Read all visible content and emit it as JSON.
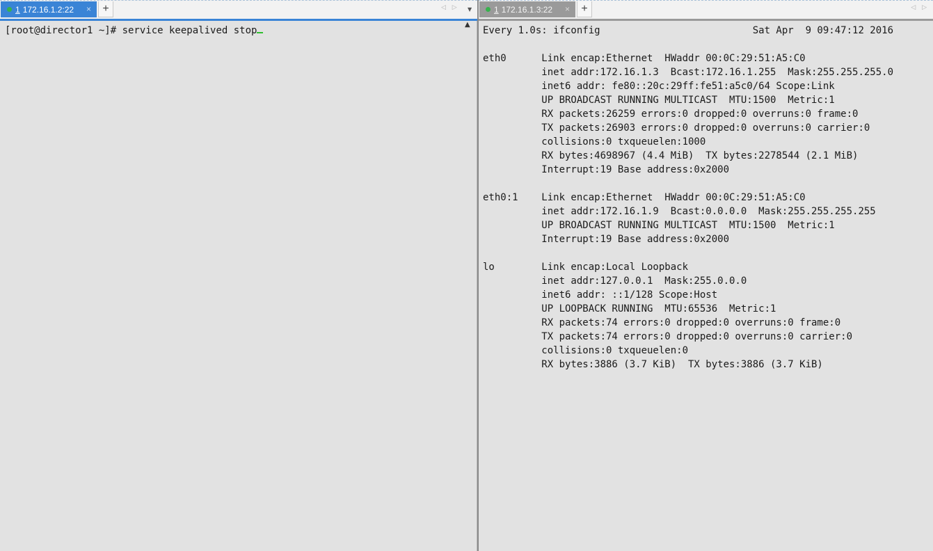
{
  "left": {
    "tab": {
      "number": "1",
      "title": "172.16.1.2:22",
      "close": "×"
    },
    "new_tab": "+",
    "prompt": "[root@director1 ~]# ",
    "command": "service keepalived stop"
  },
  "right": {
    "tab": {
      "number": "1",
      "title": "172.16.1.3:22",
      "close": "×"
    },
    "new_tab": "+",
    "lines": [
      "Every 1.0s: ifconfig                          Sat Apr  9 09:47:12 2016",
      "",
      "eth0      Link encap:Ethernet  HWaddr 00:0C:29:51:A5:C0",
      "          inet addr:172.16.1.3  Bcast:172.16.1.255  Mask:255.255.255.0",
      "          inet6 addr: fe80::20c:29ff:fe51:a5c0/64 Scope:Link",
      "          UP BROADCAST RUNNING MULTICAST  MTU:1500  Metric:1",
      "          RX packets:26259 errors:0 dropped:0 overruns:0 frame:0",
      "          TX packets:26903 errors:0 dropped:0 overruns:0 carrier:0",
      "          collisions:0 txqueuelen:1000",
      "          RX bytes:4698967 (4.4 MiB)  TX bytes:2278544 (2.1 MiB)",
      "          Interrupt:19 Base address:0x2000",
      "",
      "eth0:1    Link encap:Ethernet  HWaddr 00:0C:29:51:A5:C0",
      "          inet addr:172.16.1.9  Bcast:0.0.0.0  Mask:255.255.255.255",
      "          UP BROADCAST RUNNING MULTICAST  MTU:1500  Metric:1",
      "          Interrupt:19 Base address:0x2000",
      "",
      "lo        Link encap:Local Loopback",
      "          inet addr:127.0.0.1  Mask:255.0.0.0",
      "          inet6 addr: ::1/128 Scope:Host",
      "          UP LOOPBACK RUNNING  MTU:65536  Metric:1",
      "          RX packets:74 errors:0 dropped:0 overruns:0 frame:0",
      "          TX packets:74 errors:0 dropped:0 overruns:0 carrier:0",
      "          collisions:0 txqueuelen:0",
      "          RX bytes:3886 (3.7 KiB)  TX bytes:3886 (3.7 KiB)"
    ]
  },
  "icons": {
    "nav_arrows": "◁ ▷",
    "dropdown": "▼",
    "scroll_up": "▲"
  },
  "colors": {
    "active_tab": "#3a84d6",
    "inactive_tab": "#9a9a9a",
    "status_dot": "#37b24d",
    "cursor": "#2fbf2f",
    "terminal_bg": "#e2e2e2"
  }
}
